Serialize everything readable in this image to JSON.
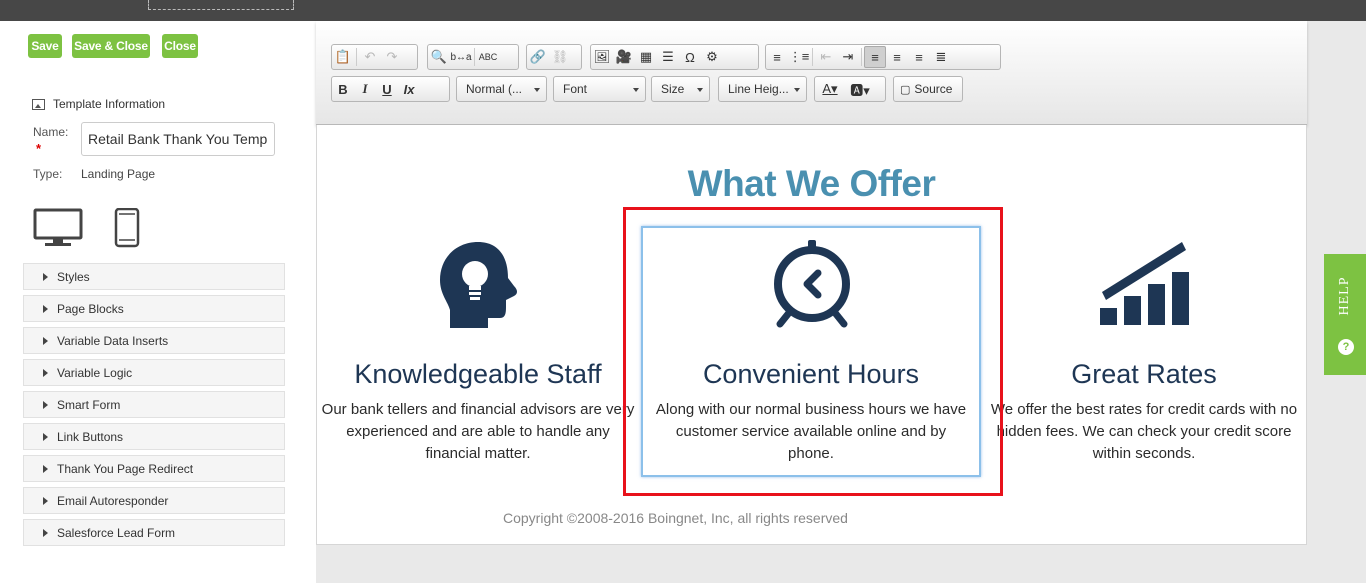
{
  "left_panel": {
    "buttons": {
      "save": "Save",
      "save_close": "Save & Close",
      "close": "Close"
    },
    "section_title": "Template Information",
    "name_label": "Name:",
    "name_value": "Retail Bank Thank You Temp",
    "type_label": "Type:",
    "type_value": "Landing Page",
    "accordion": [
      "Styles",
      "Page Blocks",
      "Variable Data Inserts",
      "Variable Logic",
      "Smart Form",
      "Link Buttons",
      "Thank You Page Redirect",
      "Email Autoresponder",
      "Salesforce Lead Form"
    ]
  },
  "toolbar": {
    "format": "Normal (...",
    "font": "Font",
    "size": "Size",
    "line_height": "Line Heig...",
    "source": "Source",
    "bold": "B",
    "italic": "I",
    "underline": "U",
    "omega": "Ω"
  },
  "content": {
    "heading": "What We Offer",
    "columns": [
      {
        "title": "Knowledgeable Staff",
        "text": "Our bank tellers and financial advisors are very experienced and are able to handle any financial matter."
      },
      {
        "title": "Convenient Hours",
        "text": "Along with our normal business hours we have customer service available online and by phone."
      },
      {
        "title": "Great Rates",
        "text": "We offer the best rates for credit cards with no hidden fees. We can check your credit score within seconds."
      }
    ],
    "copyright": "Copyright ©2008-2016 Boingnet, Inc, all rights reserved"
  },
  "help": {
    "label": "HELP"
  },
  "colors": {
    "green": "#7dc242",
    "heading": "#4a90b0",
    "navy": "#1e3654",
    "highlight": "#e8111b"
  }
}
